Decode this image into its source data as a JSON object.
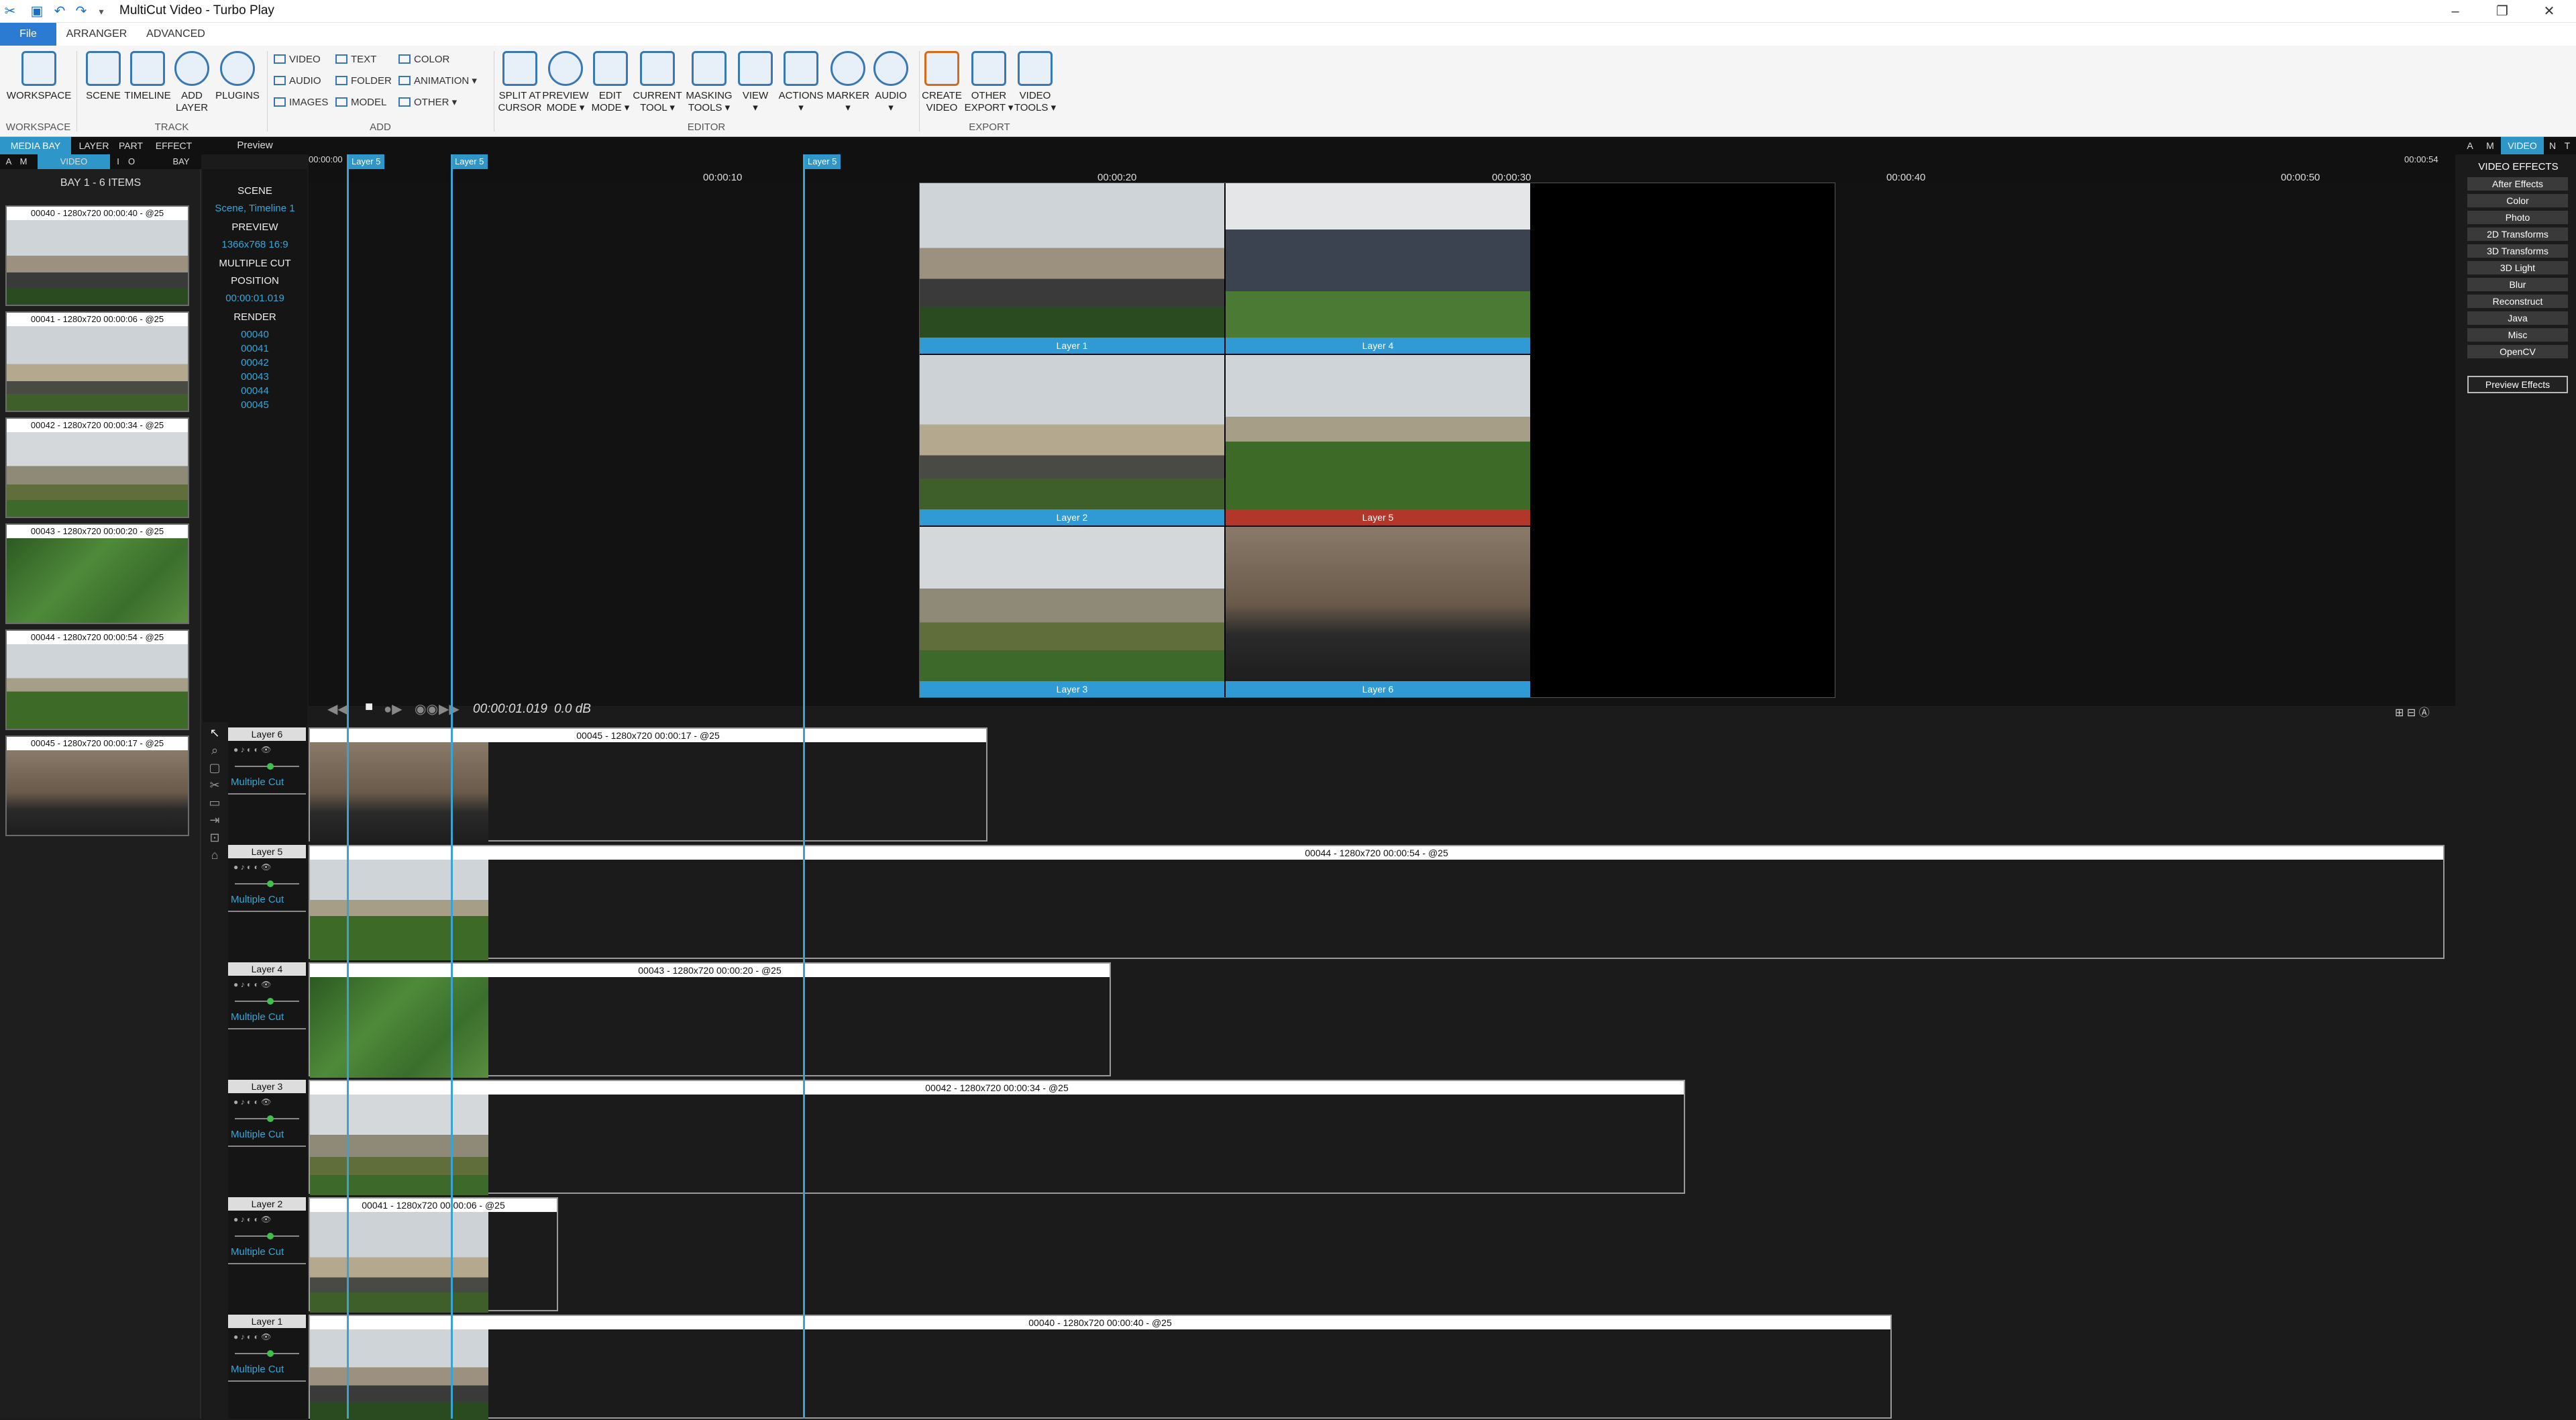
{
  "window": {
    "title": "MultiCut Video - Turbo Play"
  },
  "menu": {
    "file": "File",
    "tabs": [
      "ARRANGER",
      "ADVANCED"
    ]
  },
  "ribbon": {
    "workspace": "WORKSPACE",
    "scene": "SCENE",
    "timeline": "TIMELINE",
    "add_layer": "ADD\nLAYER",
    "plugins": "PLUGINS",
    "add_small": [
      "VIDEO",
      "AUDIO",
      "IMAGES",
      "TEXT",
      "FOLDER",
      "MODEL",
      "COLOR",
      "ANIMATION ▾",
      "OTHER ▾"
    ],
    "editor": [
      "SPLIT AT\nCURSOR",
      "PREVIEW\nMODE ▾",
      "EDIT\nMODE ▾",
      "CURRENT\nTOOL ▾",
      "MASKING\nTOOLS ▾",
      "VIEW\n▾",
      "ACTIONS\n▾",
      "MARKER\n▾",
      "AUDIO\n▾"
    ],
    "export": [
      "CREATE\nVIDEO",
      "OTHER\nEXPORT ▾",
      "VIDEO\nTOOLS ▾"
    ],
    "groups": {
      "workspace": "WORKSPACE",
      "track": "TRACK",
      "add": "ADD",
      "editor": "EDITOR",
      "export": "EXPORT"
    }
  },
  "panel_tabs": [
    "MEDIA BAY",
    "LAYER",
    "PART",
    "EFFECT"
  ],
  "sub_tabs": [
    "A",
    "M",
    "VIDEO",
    "I",
    "O",
    "BAY"
  ],
  "preview_label": "Preview",
  "right_tabs": [
    "A",
    "M",
    "VIDEO",
    "N",
    "T"
  ],
  "media_bay": {
    "title": "BAY 1 - 6 ITEMS",
    "clips": [
      "00040 - 1280x720 00:00:40 - @25",
      "00041 - 1280x720 00:00:06 - @25",
      "00042 - 1280x720 00:00:34 - @25",
      "00043 - 1280x720 00:00:20 - @25",
      "00044 - 1280x720 00:00:54 - @25",
      "00045 - 1280x720 00:00:17 - @25"
    ]
  },
  "info": {
    "scene_h": "SCENE",
    "scene_v": "Scene, Timeline 1",
    "preview_h": "PREVIEW",
    "preview_v": "1366x768 16:9",
    "multicut_h": "MULTIPLE CUT",
    "position_h": "POSITION",
    "position_v": "00:00:01.019",
    "render_h": "RENDER",
    "render_items": [
      "00040",
      "00041",
      "00042",
      "00043",
      "00044",
      "00045"
    ]
  },
  "ruler": {
    "start": "00:00:00",
    "ticks": [
      "00:00:10",
      "00:00:20",
      "00:00:30",
      "00:00:40",
      "00:00:50"
    ],
    "end": "00:00:54",
    "markers": [
      "Layer 5",
      "Layer 5",
      "Layer 5"
    ]
  },
  "preview_tiles": [
    "Layer 1",
    "Layer 4",
    "Layer 2",
    "Layer 5",
    "Layer 3",
    "Layer 6"
  ],
  "transport": {
    "timecode": "00:00:01.019",
    "db": "0.0 dB"
  },
  "layers": [
    {
      "name": "Layer 6",
      "mode": "Multiple Cut",
      "clip": "00045 - 1280x720 00:00:17 - @25"
    },
    {
      "name": "Layer 5",
      "mode": "Multiple Cut",
      "clip": "00044 - 1280x720 00:00:54 - @25"
    },
    {
      "name": "Layer 4",
      "mode": "Multiple Cut",
      "clip": "00043 - 1280x720 00:00:20 - @25"
    },
    {
      "name": "Layer 3",
      "mode": "Multiple Cut",
      "clip": "00042 - 1280x720 00:00:34 - @25"
    },
    {
      "name": "Layer 2",
      "mode": "Multiple Cut",
      "clip": "00041 - 1280x720 00:00:06 - @25"
    },
    {
      "name": "Layer 1",
      "mode": "Multiple Cut",
      "clip": "00040 - 1280x720 00:00:40 - @25"
    }
  ],
  "video_effects": {
    "title": "VIDEO EFFECTS",
    "items": [
      "After Effects",
      "Color",
      "Photo",
      "2D Transforms",
      "3D Transforms",
      "3D Light",
      "Blur",
      "Reconstruct",
      "Java",
      "Misc",
      "OpenCV"
    ],
    "preview_button": "Preview Effects"
  },
  "colors": {
    "accent": "#2e96c9",
    "file_tab": "#2b7bd2",
    "active_layer": "#b3362a"
  }
}
